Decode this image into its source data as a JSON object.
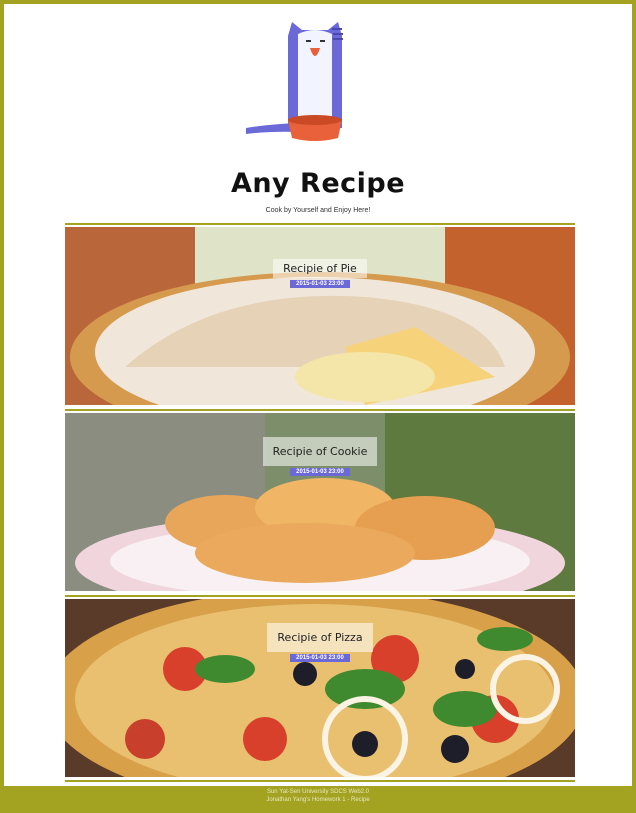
{
  "site": {
    "title": "Any Recipe",
    "subtitle": "Cook by Yourself and Enjoy Here!"
  },
  "recipes": [
    {
      "title": "Recipie of Pie",
      "date": "2015-01-03 23:00"
    },
    {
      "title": "Recipie of Cookie",
      "date": "2015-01-03 23:00"
    },
    {
      "title": "Recipie of Pizza",
      "date": "2015-01-03 23:00"
    }
  ],
  "footer": {
    "line1": "Sun Yat-Sen University SDCS Web2.0",
    "line2": "Jonathan Yang's Homework 1 - Recipe"
  },
  "colors": {
    "accent": "#a3a321",
    "date_badge": "#6b68d8",
    "cat": "#6b68d8",
    "bowl": "#e8613a"
  },
  "icons": {
    "logo": "cat-with-bowl-logo"
  }
}
